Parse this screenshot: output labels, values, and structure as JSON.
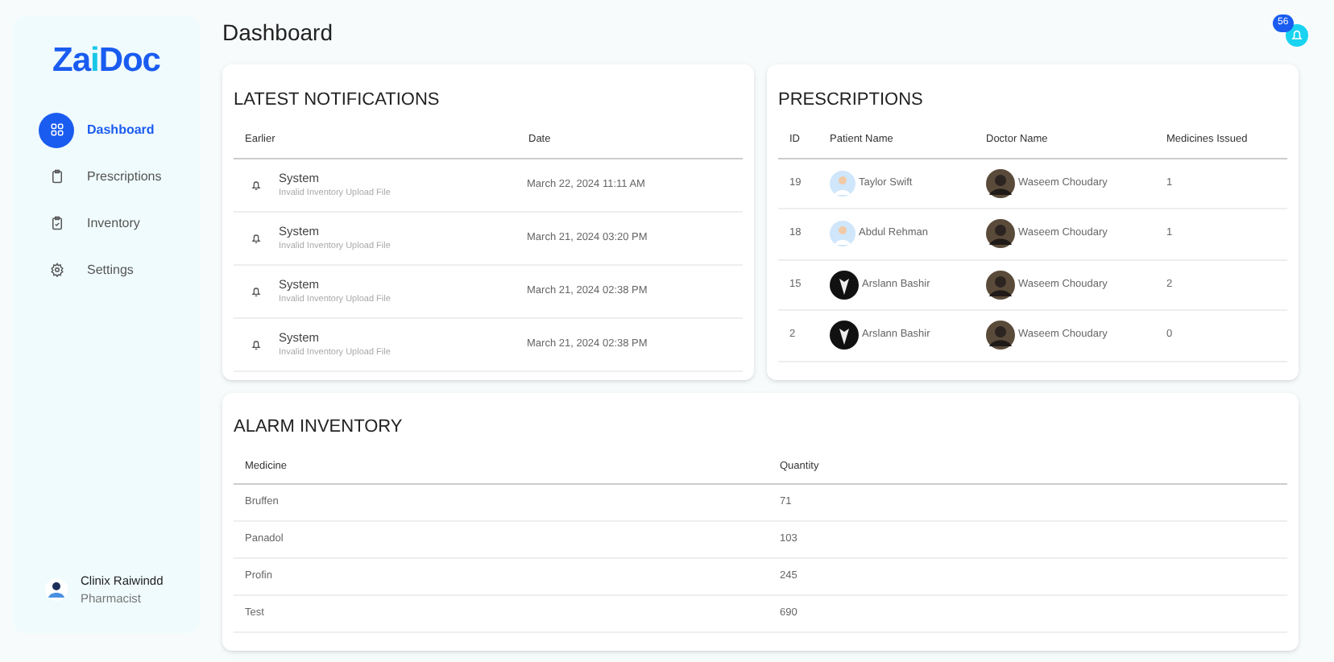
{
  "sidebar": {
    "logo": {
      "primary": "Za",
      "accent": "i",
      "rest": "Doc"
    },
    "items": [
      {
        "label": "Dashboard",
        "selected": true
      },
      {
        "label": "Prescriptions",
        "selected": false
      },
      {
        "label": "Inventory",
        "selected": false
      },
      {
        "label": "Settings",
        "selected": false
      }
    ],
    "user": {
      "name": "Clinix Raiwindd",
      "role": "Pharmacist"
    }
  },
  "header": {
    "title": "Dashboard",
    "notification_count": "56"
  },
  "notifications": {
    "title": "LATEST NOTIFICATIONS",
    "columns": [
      "Earlier",
      "Date"
    ],
    "rows": [
      {
        "sender": "System",
        "message": "Invalid Inventory Upload File",
        "date": "March 22, 2024 11:11 AM"
      },
      {
        "sender": "System",
        "message": "Invalid Inventory Upload File",
        "date": "March 21, 2024 03:20 PM"
      },
      {
        "sender": "System",
        "message": "Invalid Inventory Upload File",
        "date": "March 21, 2024 02:38 PM"
      },
      {
        "sender": "System",
        "message": "Invalid Inventory Upload File",
        "date": "March 21, 2024 02:38 PM"
      }
    ]
  },
  "prescriptions": {
    "title": "PRESCRIPTIONS",
    "columns": [
      "ID",
      "Patient Name",
      "Doctor Name",
      "Medicines Issued"
    ],
    "rows": [
      {
        "kind": "light",
        "id": "19",
        "patient": "Taylor Swift",
        "doctor": "Waseem Choudary",
        "issued": "1"
      },
      {
        "kind": "light",
        "id": "18",
        "patient": "Abdul Rehman",
        "doctor": "Waseem Choudary",
        "issued": "1"
      },
      {
        "kind": "dark",
        "id": "15",
        "patient": "Arslann Bashir",
        "doctor": "Waseem Choudary",
        "issued": "2"
      },
      {
        "kind": "dark",
        "id": "2",
        "patient": "Arslann Bashir",
        "doctor": "Waseem Choudary",
        "issued": "0"
      }
    ]
  },
  "alarm_inventory": {
    "title": "ALARM INVENTORY",
    "columns": [
      "Medicine",
      "Quantity"
    ],
    "rows": [
      {
        "medicine": "Bruffen",
        "quantity": "71"
      },
      {
        "medicine": "Panadol",
        "quantity": "103"
      },
      {
        "medicine": "Profin",
        "quantity": "245"
      },
      {
        "medicine": "Test",
        "quantity": "690"
      }
    ]
  }
}
